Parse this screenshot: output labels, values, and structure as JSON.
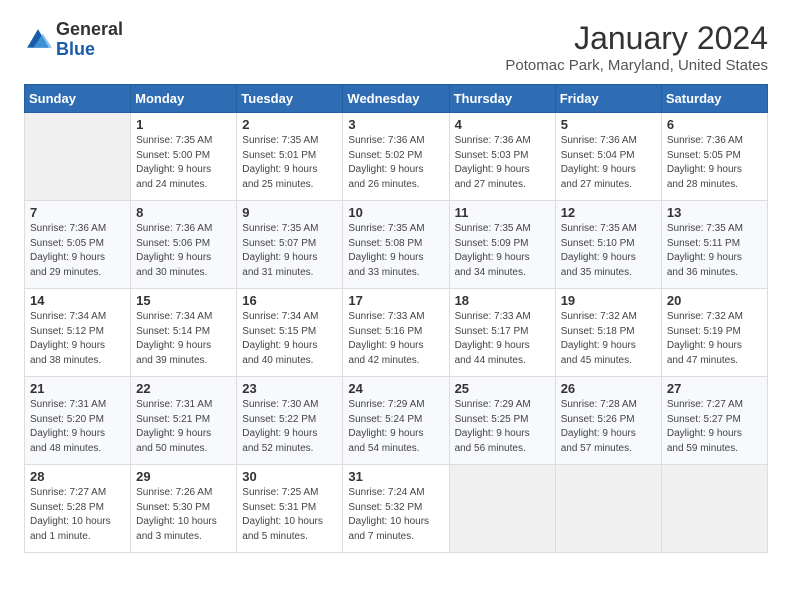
{
  "header": {
    "logo_general": "General",
    "logo_blue": "Blue",
    "month_year": "January 2024",
    "location": "Potomac Park, Maryland, United States"
  },
  "calendar": {
    "headers": [
      "Sunday",
      "Monday",
      "Tuesday",
      "Wednesday",
      "Thursday",
      "Friday",
      "Saturday"
    ],
    "weeks": [
      [
        {
          "day": "",
          "info": ""
        },
        {
          "day": "1",
          "info": "Sunrise: 7:35 AM\nSunset: 5:00 PM\nDaylight: 9 hours\nand 24 minutes."
        },
        {
          "day": "2",
          "info": "Sunrise: 7:35 AM\nSunset: 5:01 PM\nDaylight: 9 hours\nand 25 minutes."
        },
        {
          "day": "3",
          "info": "Sunrise: 7:36 AM\nSunset: 5:02 PM\nDaylight: 9 hours\nand 26 minutes."
        },
        {
          "day": "4",
          "info": "Sunrise: 7:36 AM\nSunset: 5:03 PM\nDaylight: 9 hours\nand 27 minutes."
        },
        {
          "day": "5",
          "info": "Sunrise: 7:36 AM\nSunset: 5:04 PM\nDaylight: 9 hours\nand 27 minutes."
        },
        {
          "day": "6",
          "info": "Sunrise: 7:36 AM\nSunset: 5:05 PM\nDaylight: 9 hours\nand 28 minutes."
        }
      ],
      [
        {
          "day": "7",
          "info": "Sunrise: 7:36 AM\nSunset: 5:05 PM\nDaylight: 9 hours\nand 29 minutes."
        },
        {
          "day": "8",
          "info": "Sunrise: 7:36 AM\nSunset: 5:06 PM\nDaylight: 9 hours\nand 30 minutes."
        },
        {
          "day": "9",
          "info": "Sunrise: 7:35 AM\nSunset: 5:07 PM\nDaylight: 9 hours\nand 31 minutes."
        },
        {
          "day": "10",
          "info": "Sunrise: 7:35 AM\nSunset: 5:08 PM\nDaylight: 9 hours\nand 33 minutes."
        },
        {
          "day": "11",
          "info": "Sunrise: 7:35 AM\nSunset: 5:09 PM\nDaylight: 9 hours\nand 34 minutes."
        },
        {
          "day": "12",
          "info": "Sunrise: 7:35 AM\nSunset: 5:10 PM\nDaylight: 9 hours\nand 35 minutes."
        },
        {
          "day": "13",
          "info": "Sunrise: 7:35 AM\nSunset: 5:11 PM\nDaylight: 9 hours\nand 36 minutes."
        }
      ],
      [
        {
          "day": "14",
          "info": "Sunrise: 7:34 AM\nSunset: 5:12 PM\nDaylight: 9 hours\nand 38 minutes."
        },
        {
          "day": "15",
          "info": "Sunrise: 7:34 AM\nSunset: 5:14 PM\nDaylight: 9 hours\nand 39 minutes."
        },
        {
          "day": "16",
          "info": "Sunrise: 7:34 AM\nSunset: 5:15 PM\nDaylight: 9 hours\nand 40 minutes."
        },
        {
          "day": "17",
          "info": "Sunrise: 7:33 AM\nSunset: 5:16 PM\nDaylight: 9 hours\nand 42 minutes."
        },
        {
          "day": "18",
          "info": "Sunrise: 7:33 AM\nSunset: 5:17 PM\nDaylight: 9 hours\nand 44 minutes."
        },
        {
          "day": "19",
          "info": "Sunrise: 7:32 AM\nSunset: 5:18 PM\nDaylight: 9 hours\nand 45 minutes."
        },
        {
          "day": "20",
          "info": "Sunrise: 7:32 AM\nSunset: 5:19 PM\nDaylight: 9 hours\nand 47 minutes."
        }
      ],
      [
        {
          "day": "21",
          "info": "Sunrise: 7:31 AM\nSunset: 5:20 PM\nDaylight: 9 hours\nand 48 minutes."
        },
        {
          "day": "22",
          "info": "Sunrise: 7:31 AM\nSunset: 5:21 PM\nDaylight: 9 hours\nand 50 minutes."
        },
        {
          "day": "23",
          "info": "Sunrise: 7:30 AM\nSunset: 5:22 PM\nDaylight: 9 hours\nand 52 minutes."
        },
        {
          "day": "24",
          "info": "Sunrise: 7:29 AM\nSunset: 5:24 PM\nDaylight: 9 hours\nand 54 minutes."
        },
        {
          "day": "25",
          "info": "Sunrise: 7:29 AM\nSunset: 5:25 PM\nDaylight: 9 hours\nand 56 minutes."
        },
        {
          "day": "26",
          "info": "Sunrise: 7:28 AM\nSunset: 5:26 PM\nDaylight: 9 hours\nand 57 minutes."
        },
        {
          "day": "27",
          "info": "Sunrise: 7:27 AM\nSunset: 5:27 PM\nDaylight: 9 hours\nand 59 minutes."
        }
      ],
      [
        {
          "day": "28",
          "info": "Sunrise: 7:27 AM\nSunset: 5:28 PM\nDaylight: 10 hours\nand 1 minute."
        },
        {
          "day": "29",
          "info": "Sunrise: 7:26 AM\nSunset: 5:30 PM\nDaylight: 10 hours\nand 3 minutes."
        },
        {
          "day": "30",
          "info": "Sunrise: 7:25 AM\nSunset: 5:31 PM\nDaylight: 10 hours\nand 5 minutes."
        },
        {
          "day": "31",
          "info": "Sunrise: 7:24 AM\nSunset: 5:32 PM\nDaylight: 10 hours\nand 7 minutes."
        },
        {
          "day": "",
          "info": ""
        },
        {
          "day": "",
          "info": ""
        },
        {
          "day": "",
          "info": ""
        }
      ]
    ]
  }
}
